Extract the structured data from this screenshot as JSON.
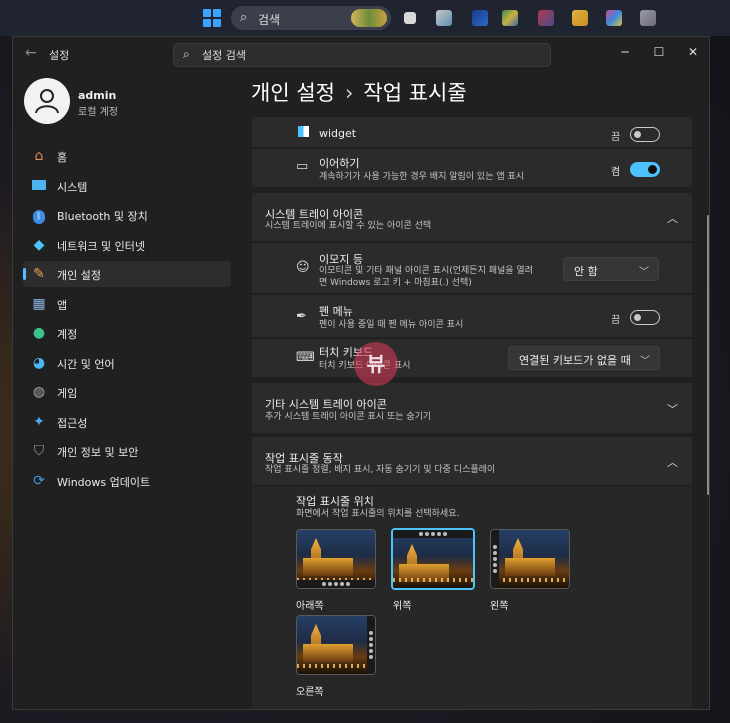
{
  "taskbar": {
    "search_text": "검색"
  },
  "window": {
    "app_title": "설정",
    "search_placeholder": "설정 검색",
    "controls": {
      "minimize": "─",
      "maximize": "☐",
      "close": "✕"
    }
  },
  "profile": {
    "name": "admin",
    "account_type": "로컬 계정"
  },
  "sidebar": {
    "items": [
      {
        "label": "홈",
        "icon": "home-icon",
        "color": "#e88a52"
      },
      {
        "label": "시스템",
        "icon": "monitor-icon",
        "color": "#4cb4f0"
      },
      {
        "label": "Bluetooth 및 장치",
        "icon": "bluetooth-icon",
        "color": "#3a8ee6"
      },
      {
        "label": "네트워크 및 인터넷",
        "icon": "wifi-icon",
        "color": "#4cc2ff"
      },
      {
        "label": "개인 설정",
        "icon": "brush-icon",
        "color": "#e6a24c",
        "active": true
      },
      {
        "label": "앱",
        "icon": "apps-icon",
        "color": "#8ab4e6"
      },
      {
        "label": "계정",
        "icon": "person-icon",
        "color": "#3ac48a"
      },
      {
        "label": "시간 및 언어",
        "icon": "globe-clock-icon",
        "color": "#4cb4f0"
      },
      {
        "label": "게임",
        "icon": "gamepad-icon",
        "color": "#aaaaaa"
      },
      {
        "label": "접근성",
        "icon": "accessibility-icon",
        "color": "#4ca8f0"
      },
      {
        "label": "개인 정보 및 보안",
        "icon": "shield-icon",
        "color": "#9a9a9a"
      },
      {
        "label": "Windows 업데이트",
        "icon": "update-icon",
        "color": "#3a9ae6"
      }
    ]
  },
  "breadcrumb": {
    "parent": "개인 설정",
    "separator": "›",
    "current": "작업 표시줄"
  },
  "content": {
    "widget_row": {
      "title": "widget",
      "state": "끔",
      "on": false
    },
    "continue_row": {
      "title": "이어하기",
      "desc": "계속하기가 사용 가능한 경우 배지 알림이 있는 앱 표시",
      "state": "켬",
      "on": true
    },
    "tray_section": {
      "title": "시스템 트레이 아이콘",
      "desc": "시스템 트레이에 표시할 수 있는 아이콘 선택"
    },
    "emoji_row": {
      "title": "이모지 등",
      "desc_line1": "이모티콘 및 기타 패널 아이콘 표시(언제든지 패널을 열려",
      "desc_line2": "면 Windows 로고 키 + 마침표(.) 선택)",
      "value": "안 함"
    },
    "pen_row": {
      "title": "펜 메뉴",
      "desc": "펜이 사용 중일 때 펜 메뉴 아이콘 표시",
      "state": "끔",
      "on": false
    },
    "touch_row": {
      "title": "터치 키보드",
      "desc": "터치 키보드 아이콘 표시",
      "value": "연결된 키보드가 없을 때"
    },
    "other_tray": {
      "title": "기타 시스템 트레이 아이콘",
      "desc": "추가 시스템 트레이 아이콘 표시 또는 숨기기"
    },
    "behavior": {
      "title": "작업 표시줄 동작",
      "desc": "작업 표시줄 정렬, 배지 표시, 자동 숨기기 및 다중 디스플레이"
    },
    "position": {
      "title": "작업 표시줄 위치",
      "desc": "화면에서 작업 표시줄의 위치를 선택하세요.",
      "options": [
        "아래쪽",
        "위쪽",
        "왼쪽",
        "오른쪽"
      ],
      "selected": "위쪽"
    }
  },
  "watermark": {
    "text": "뷰"
  },
  "colors": {
    "accent": "#4cc2ff",
    "window_bg": "#202020",
    "card_bg": "#2b2b2b"
  }
}
